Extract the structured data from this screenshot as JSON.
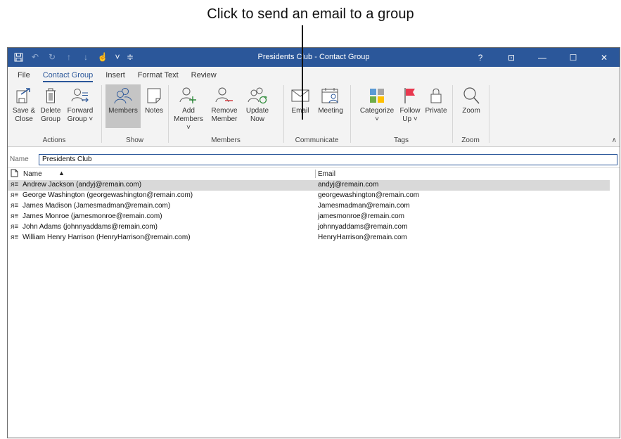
{
  "callout": {
    "text": "Click to send an email to a group"
  },
  "window": {
    "title": "Presidents Club  -  Contact Group",
    "controls": [
      "?",
      "⊡",
      "—",
      "☐",
      "✕"
    ]
  },
  "tabs": [
    "File",
    "Contact Group",
    "Insert",
    "Format Text",
    "Review"
  ],
  "ribbon": {
    "actions": {
      "label": "Actions",
      "save_close": [
        "Save &",
        "Close"
      ],
      "delete_group": [
        "Delete",
        "Group"
      ],
      "forward_group": [
        "Forward",
        "Group ˅"
      ]
    },
    "show": {
      "label": "Show",
      "members": "Members",
      "notes": "Notes"
    },
    "members": {
      "label": "Members",
      "add_members": [
        "Add",
        "Members ˅"
      ],
      "remove_member": [
        "Remove",
        "Member"
      ],
      "update_now": [
        "Update",
        "Now"
      ]
    },
    "communicate": {
      "label": "Communicate",
      "email": "Email",
      "meeting": "Meeting"
    },
    "tags": {
      "label": "Tags",
      "categorize": [
        "Categorize",
        "˅"
      ],
      "follow_up": [
        "Follow",
        "Up ˅"
      ],
      "private": "Private"
    },
    "zoom": {
      "label": "Zoom",
      "zoom": "Zoom"
    },
    "collapse": "∧"
  },
  "name_field": {
    "label": "Name",
    "value": "Presidents Club"
  },
  "list": {
    "columns": {
      "name": "Name",
      "email": "Email"
    },
    "rows": [
      {
        "name": "Andrew Jackson (andyj@remain.com)",
        "email": "andyj@remain.com"
      },
      {
        "name": "George Washington (georgewashington@remain.com)",
        "email": "georgewashington@remain.com"
      },
      {
        "name": "James Madison (Jamesmadman@remain.com)",
        "email": "Jamesmadman@remain.com"
      },
      {
        "name": "James Monroe (jamesmonroe@remain.com)",
        "email": "jamesmonroe@remain.com"
      },
      {
        "name": "John Adams (johnnyaddams@remain.com)",
        "email": "johnnyaddams@remain.com"
      },
      {
        "name": "William Henry Harrison (HenryHarrison@remain.com)",
        "email": "HenryHarrison@remain.com"
      }
    ]
  },
  "colors": {
    "accent": "#2b579a",
    "ribbon_bg": "#f3f3f3",
    "selected_row": "#d9d9d9",
    "flag_red": "#e8384f"
  }
}
